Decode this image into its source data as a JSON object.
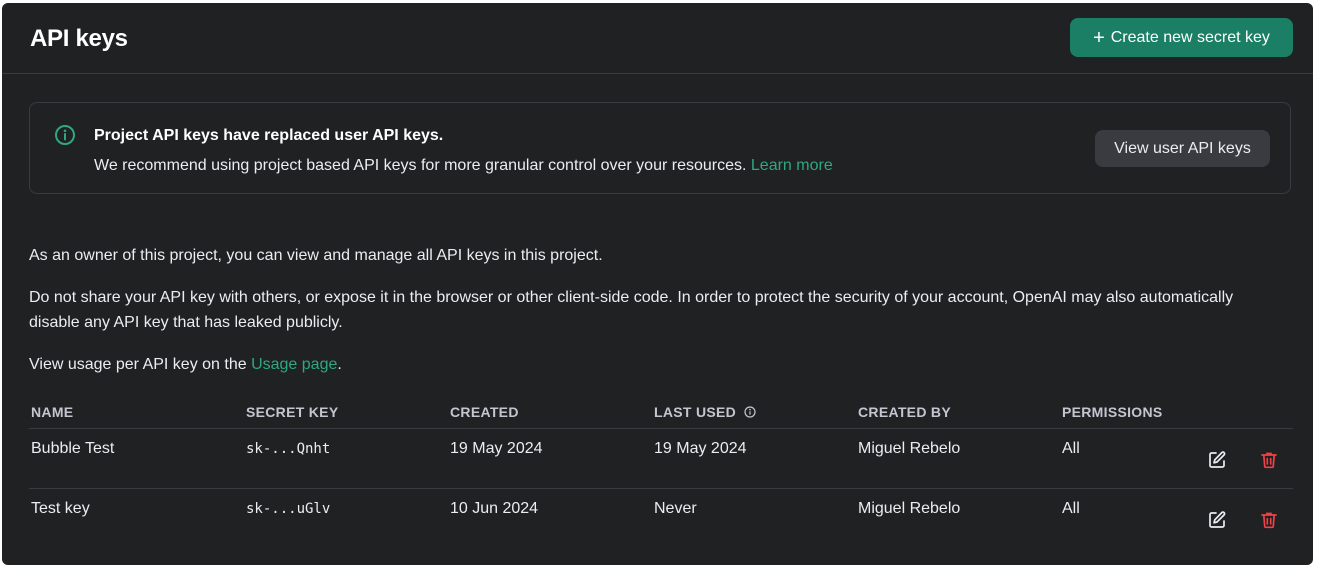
{
  "header": {
    "title": "API keys",
    "create_button_label": "Create new secret key"
  },
  "notice": {
    "title": "Project API keys have replaced user API keys.",
    "body": "We recommend using project based API keys for more granular control over your resources.",
    "learn_more": "Learn more",
    "view_user_keys_button": "View user API keys"
  },
  "paragraphs": {
    "owner": "As an owner of this project, you can view and manage all API keys in this project.",
    "warning": "Do not share your API key with others, or expose it in the browser or other client-side code. In order to protect the security of your account, OpenAI may also automatically disable any API key that has leaked publicly.",
    "usage_prefix": "View usage per API key on the",
    "usage_link": "Usage page",
    "usage_suffix": "."
  },
  "table": {
    "columns": {
      "name": "NAME",
      "secret_key": "SECRET KEY",
      "created": "CREATED",
      "last_used": "LAST USED",
      "created_by": "CREATED BY",
      "permissions": "PERMISSIONS"
    },
    "rows": [
      {
        "name": "Bubble Test",
        "secret_key": "sk-...Qnht",
        "created": "19 May 2024",
        "last_used": "19 May 2024",
        "created_by": "Miguel Rebelo",
        "permissions": "All"
      },
      {
        "name": "Test key",
        "secret_key": "sk-...uGlv",
        "created": "10 Jun 2024",
        "last_used": "Never",
        "created_by": "Miguel Rebelo",
        "permissions": "All"
      }
    ]
  },
  "colors": {
    "background": "#202123",
    "accent_green": "#1a7f64",
    "link_green": "#2ea87e",
    "delete_red": "#ef4146",
    "border": "#3a3b40"
  },
  "icons": {
    "create": "plus-icon",
    "notice": "info-circle-icon",
    "last_used_help": "info-circle-icon",
    "edit": "edit-pencil-icon",
    "delete": "trash-icon"
  }
}
